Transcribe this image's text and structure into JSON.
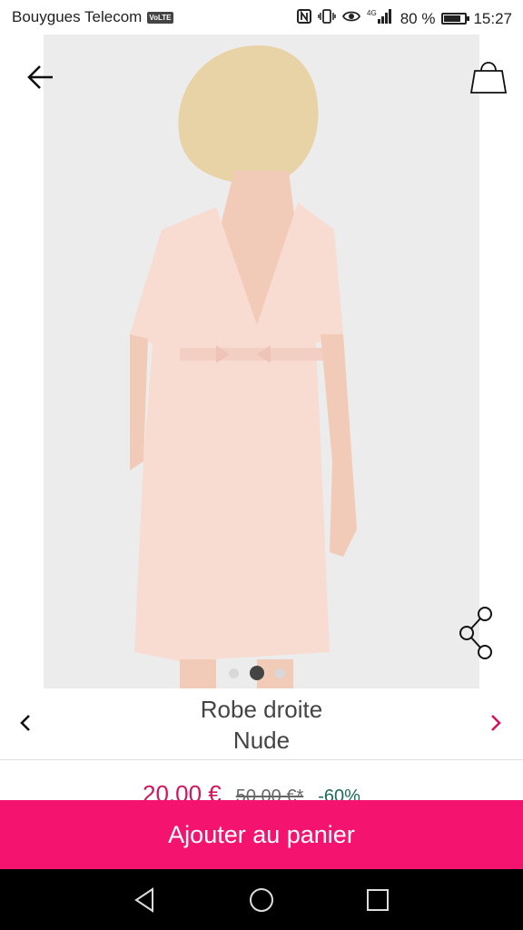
{
  "status_bar": {
    "carrier": "Bouygues Telecom",
    "volte_badge": "VoLTE",
    "nfc_icon": "nfc-icon",
    "vibrate_icon": "vibrate-icon",
    "eye_icon": "eye-comfort-icon",
    "network_type": "4G",
    "battery_percent_label": "80 %",
    "battery_level": 0.8,
    "time": "15:27"
  },
  "gallery": {
    "back_icon": "arrow-left-icon",
    "bag_icon": "shopping-bag-icon",
    "share_icon": "share-icon",
    "image_count": 3,
    "active_index": 1,
    "photo_bg": "#ececec",
    "dress_color": "#f8dcd2"
  },
  "product": {
    "name": "Robe droite",
    "color": "Nude",
    "prev_icon": "chevron-left-icon",
    "next_icon": "chevron-right-icon"
  },
  "pricing": {
    "price": "20,00 €",
    "old_price": "50,00 €*",
    "discount": "-60%"
  },
  "cta": {
    "label": "Ajouter au panier",
    "color": "#f4136f"
  },
  "navbar": {
    "back": "nav-back-icon",
    "home": "nav-home-icon",
    "recents": "nav-recents-icon"
  }
}
